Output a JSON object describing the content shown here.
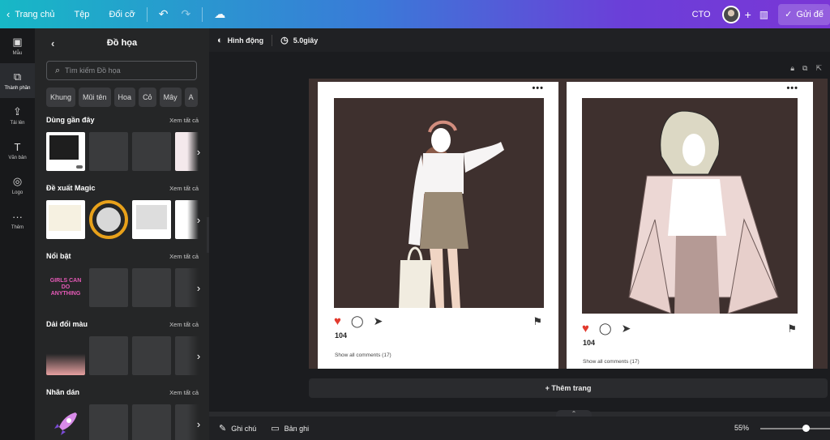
{
  "topbar": {
    "home_label": "Trang chủ",
    "file_label": "Tệp",
    "resize_label": "Đổi cỡ",
    "team_label": "CTO",
    "send_label": "Gửi đế"
  },
  "rail": [
    {
      "label": "Mẫu",
      "icon": "template-icon"
    },
    {
      "label": "Thành phần",
      "icon": "elements-icon"
    },
    {
      "label": "Tải lên",
      "icon": "upload-icon"
    },
    {
      "label": "Văn bản",
      "icon": "text-icon"
    },
    {
      "label": "Logo",
      "icon": "logo-icon"
    },
    {
      "label": "Thêm",
      "icon": "more-icon"
    }
  ],
  "panel": {
    "title": "Đồ họa",
    "search_placeholder": "Tìm kiếm Đồ họa",
    "chips": [
      "Khung",
      "Mũi tên",
      "Hoa",
      "Cỏ",
      "Mây",
      "A"
    ],
    "sections": [
      {
        "title": "Dùng gần đây",
        "see_all": "Xem tất cả"
      },
      {
        "title": "Đề xuất Magic",
        "see_all": "Xem tất cả"
      },
      {
        "title": "Nổi bật",
        "see_all": "Xem tất cả"
      },
      {
        "title": "Dải đổi màu",
        "see_all": "Xem tất cả"
      },
      {
        "title": "Nhãn dán",
        "see_all": "Xem tất cả"
      }
    ],
    "sticker_text": "GIRLS CAN DO ANYTHING"
  },
  "editor": {
    "animate_label": "Hình động",
    "duration_label": "5.0giây",
    "add_page_label": "+ Thêm trang",
    "notes_label": "Ghi chú",
    "recording_label": "Bản ghi",
    "zoom_label": "55%",
    "zoom_fraction": 0.55
  },
  "cards": [
    {
      "likes": "104",
      "comments": "Show all comments (17)"
    },
    {
      "likes": "104",
      "comments": "Show all comments (17)"
    }
  ],
  "colors": {
    "heart": "#e23a2e",
    "canvas_bg": "#3f3230",
    "topbar_start": "#17b8c6",
    "topbar_end": "#7a36d6"
  }
}
